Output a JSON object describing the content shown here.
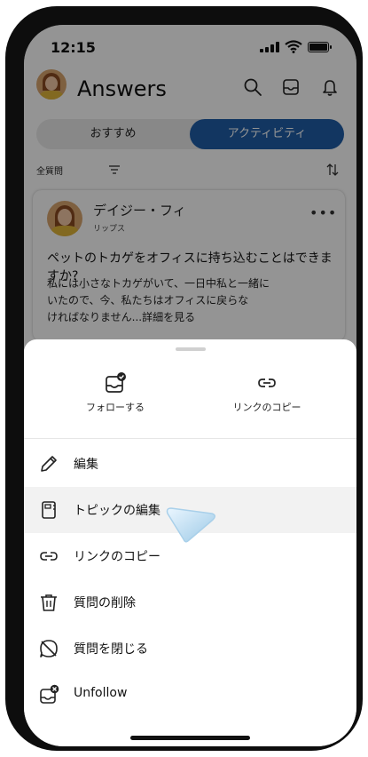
{
  "status_bar": {
    "time": "12:15"
  },
  "app_bar": {
    "title": "Answers"
  },
  "tabs": [
    {
      "label": "おすすめ",
      "selected": false
    },
    {
      "label": "アクティビティ",
      "selected": true
    }
  ],
  "filter": {
    "label": "全質問"
  },
  "post": {
    "author": "デイジー・フィ",
    "role": "リップス",
    "question": "ペットのトカゲをオフィスに持ち込むことはできますか?",
    "body_lines": [
      "私には小さなトカゲがいて、一日中私と一緒に",
      "いたので、今、私たちはオフィスに戻らな",
      "ければなりません...詳細を見る"
    ]
  },
  "sheet": {
    "top_actions": [
      {
        "label": "フォローする",
        "icon": "follow-inbox-check-icon"
      },
      {
        "label": "リンクのコピー",
        "icon": "link-icon"
      }
    ],
    "items": [
      {
        "label": "編集",
        "icon": "pencil-icon"
      },
      {
        "label": "トピックの編集",
        "icon": "topic-notebook-icon",
        "highlighted": true
      },
      {
        "label": "リンクのコピー",
        "icon": "link-icon"
      },
      {
        "label": "質問の削除",
        "icon": "trash-icon"
      },
      {
        "label": "質問を閉じる",
        "icon": "close-question-icon"
      },
      {
        "label": "Unfollow",
        "icon": "unfollow-inbox-x-icon"
      }
    ]
  },
  "colors": {
    "accent": "#1f5ea8",
    "overlay": "rgba(0,0,0,0.42)",
    "highlight_row": "#f2f2f2"
  }
}
